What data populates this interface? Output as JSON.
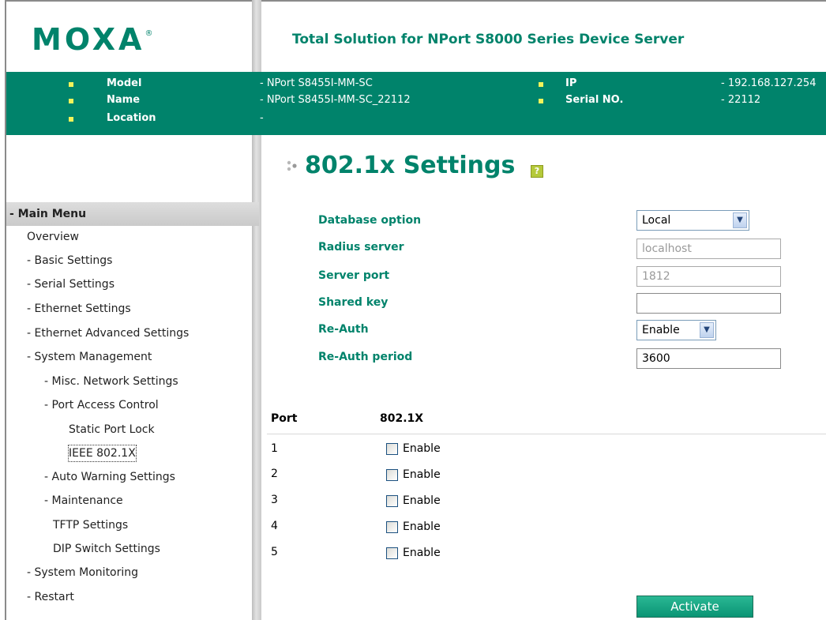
{
  "header": {
    "logo": "MOXA",
    "logo_mark": "®",
    "product_title": "Total Solution for NPort S8000 Series Device Server"
  },
  "device_info": {
    "model_label": "Model",
    "model_value": "- NPort S8455I-MM-SC",
    "name_label": "Name",
    "name_value": "- NPort S8455I-MM-SC_22112",
    "location_label": "Location",
    "location_value": "-",
    "ip_label": "IP",
    "ip_value": "- 192.168.127.254",
    "serial_label": "Serial NO.",
    "serial_value": "- 22112"
  },
  "menu": {
    "header": "- Main Menu",
    "items": [
      "Overview",
      "- Basic Settings",
      "- Serial Settings",
      "- Ethernet Settings",
      "- Ethernet Advanced Settings",
      "- System Management",
      "- Misc. Network Settings",
      "- Port Access Control",
      "Static Port Lock",
      "IEEE 802.1X",
      "- Auto Warning Settings",
      "- Maintenance",
      "TFTP Settings",
      "DIP Switch Settings",
      "- System Monitoring",
      "- Restart"
    ],
    "selected": "IEEE 802.1X"
  },
  "page": {
    "title": "802.1x Settings",
    "help_icon": "?"
  },
  "form": {
    "database_option_label": "Database option",
    "database_option_value": "Local",
    "radius_server_label": "Radius server",
    "radius_server_value": "localhost",
    "server_port_label": "Server port",
    "server_port_value": "1812",
    "shared_key_label": "Shared key",
    "shared_key_value": "",
    "reauth_label": "Re-Auth",
    "reauth_value": "Enable",
    "reauth_period_label": "Re-Auth period",
    "reauth_period_value": "3600"
  },
  "port_table": {
    "col_port": "Port",
    "col_8021x": "802.1X",
    "rows": [
      {
        "port": "1",
        "label": "Enable",
        "checked": false
      },
      {
        "port": "2",
        "label": "Enable",
        "checked": false
      },
      {
        "port": "3",
        "label": "Enable",
        "checked": false
      },
      {
        "port": "4",
        "label": "Enable",
        "checked": false
      },
      {
        "port": "5",
        "label": "Enable",
        "checked": false
      }
    ]
  },
  "actions": {
    "activate": "Activate"
  },
  "colors": {
    "brand_green": "#00836b",
    "bullet_yellow": "#f3f35a"
  },
  "icons": {
    "dropdown": "chevron-down-icon",
    "help": "help-icon",
    "title_decor": "dots-icon"
  }
}
